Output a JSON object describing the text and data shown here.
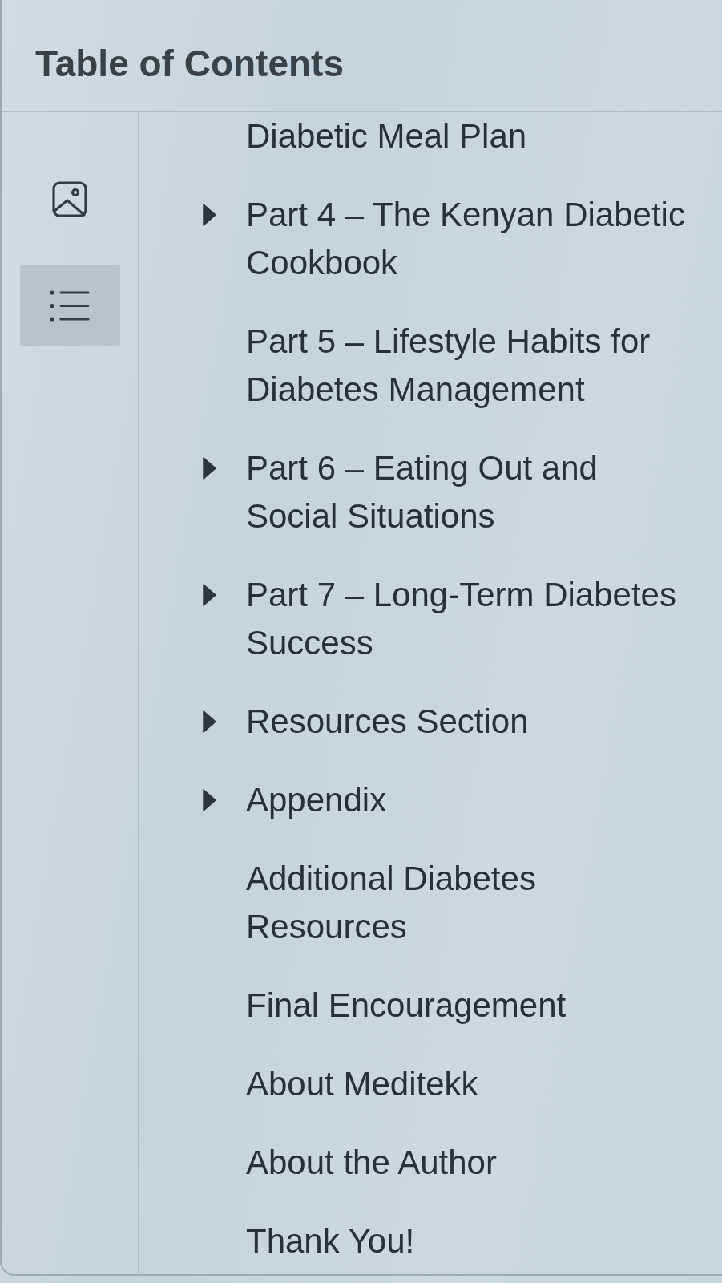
{
  "panel": {
    "title": "Table of Contents"
  },
  "rail": {
    "items": [
      {
        "kind": "image",
        "selected": false
      },
      {
        "kind": "list",
        "selected": true
      }
    ]
  },
  "toc": {
    "items": [
      {
        "label": "Diabetic Meal Plan",
        "expandable": false
      },
      {
        "label": "Part 4 – The Kenyan Diabetic Cookbook",
        "expandable": true,
        "expanded": false
      },
      {
        "label": "Part 5 – Lifestyle Habits for Diabetes Management",
        "expandable": false
      },
      {
        "label": "Part 6 – Eating Out and Social Situations",
        "expandable": true,
        "expanded": false
      },
      {
        "label": "Part 7 – Long-Term Diabetes Success",
        "expandable": true,
        "expanded": false
      },
      {
        "label": "Resources Section",
        "expandable": true,
        "expanded": false
      },
      {
        "label": "Appendix",
        "expandable": true,
        "expanded": false
      },
      {
        "label": "Additional Diabetes Resources",
        "expandable": false
      },
      {
        "label": "Final Encouragement",
        "expandable": false
      },
      {
        "label": "About Meditekk",
        "expandable": false
      },
      {
        "label": "About the Author",
        "expandable": false
      },
      {
        "label": "Thank You!",
        "expandable": false
      }
    ]
  }
}
